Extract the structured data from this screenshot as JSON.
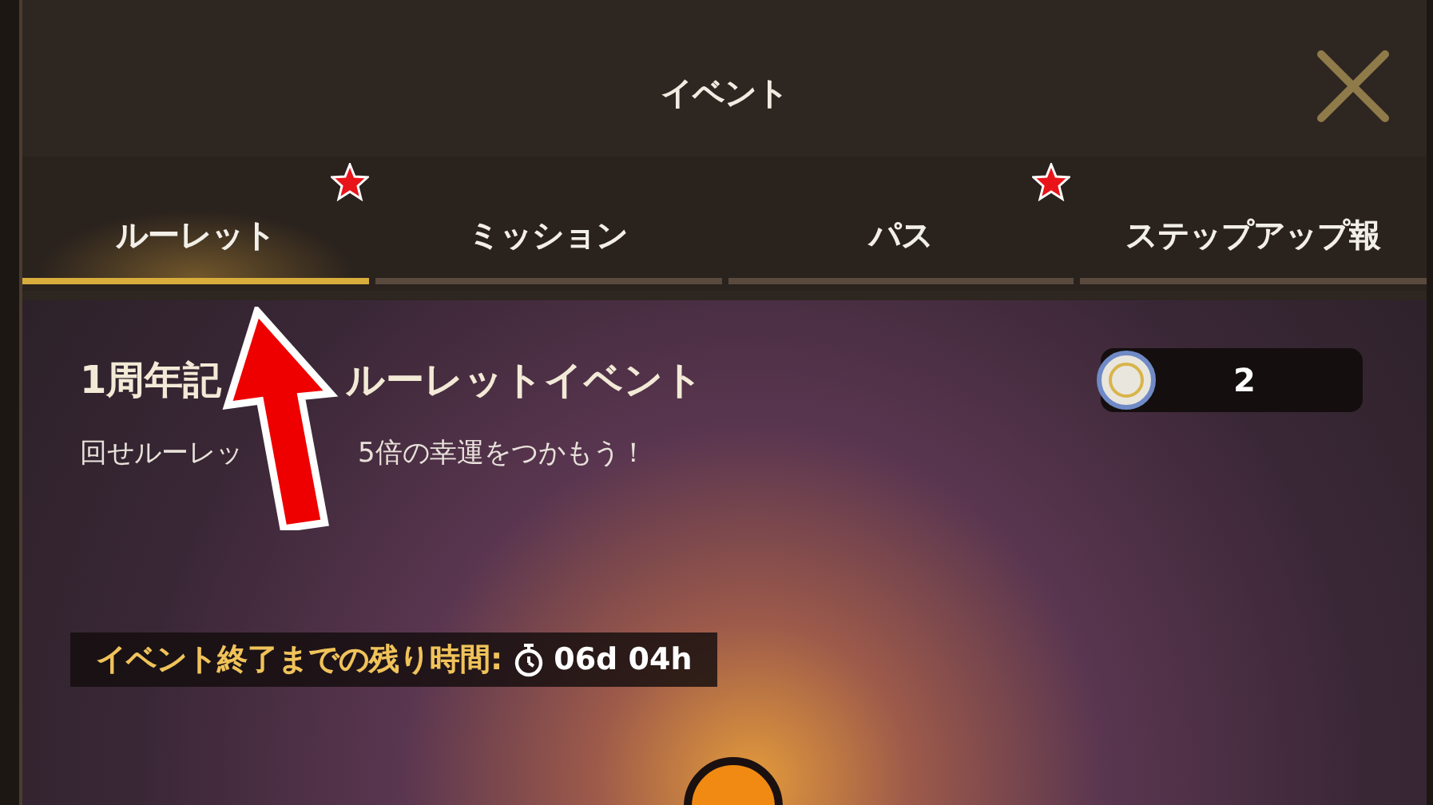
{
  "dialog": {
    "title": "イベント"
  },
  "tabs": [
    {
      "label": "ルーレット",
      "selected": true,
      "badge": true
    },
    {
      "label": "ミッション",
      "selected": false,
      "badge": false
    },
    {
      "label": "パス",
      "selected": false,
      "badge": true
    },
    {
      "label": "ステップアップ報",
      "selected": false,
      "badge": false
    }
  ],
  "event": {
    "title_parts": [
      "1周年記",
      "ルーレットイベント"
    ],
    "subtitle_parts": [
      "回せルーレッ",
      "5倍の幸運をつかもう！"
    ],
    "coin_count": "2",
    "timer_label": "イベント終了までの残り時間:",
    "timer_value": "06d 04h"
  }
}
